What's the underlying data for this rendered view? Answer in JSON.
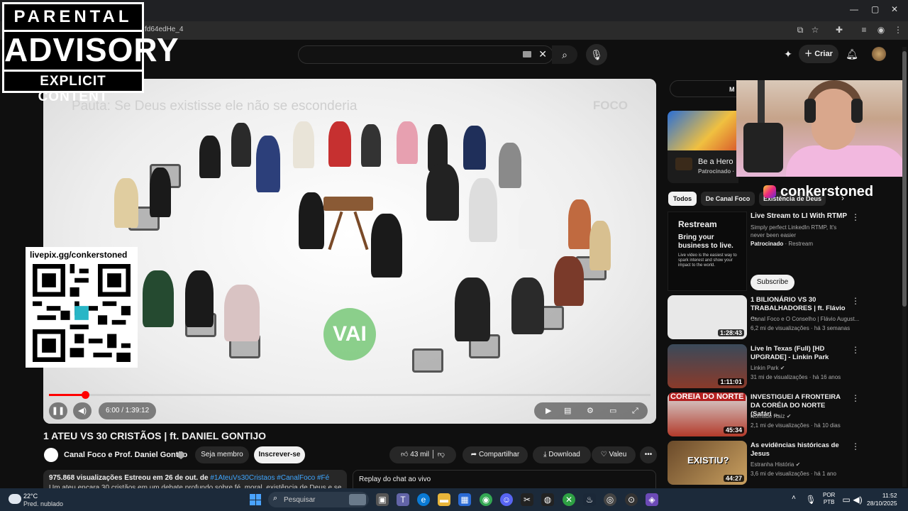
{
  "browser": {
    "url_fragment": "fd64edHe_4",
    "window_controls": {
      "minimize": "—",
      "maximize": "▢",
      "close": "✕"
    }
  },
  "overlay": {
    "parental": {
      "line1": "PARENTAL",
      "line2": "ADVISORY",
      "line3": "EXPLICIT CONTENT"
    },
    "livepix_label": "livepix.gg/conkerstoned",
    "instagram_handle": "conkerstoned"
  },
  "header": {
    "search_placeholder": "",
    "create_label": "Criar"
  },
  "video": {
    "caption": "Pauta: Se Deus existisse ele não se esconderia",
    "brand": "FOCO",
    "badge_text": "VAI",
    "time": "6:00 / 1:39:12",
    "progress_fraction": 0.06
  },
  "meta": {
    "title": "1 ATEU VS 30 CRISTÃOS | ft. DANIEL GONTIJO",
    "channel": "Canal Foco e Prof. Daniel Gontijo",
    "join_label": "Seja membro",
    "subscribe_label": "Inscrever-se",
    "likes": "43 mil",
    "share_label": "Compartilhar",
    "download_label": "Download",
    "valeu_label": "Valeu",
    "more_label": "•••",
    "desc_views": "975.868 visualizações",
    "desc_date": "Estreou em 26 de out. de",
    "desc_tags": "#1AteuVs30Cristaos #CanalFoco #Fé",
    "desc_line2": "Um ateu encara 30 cristãos em um debate profundo sobre fé, moral, existência de Deus e se",
    "chat_label": "Replay do chat ao vivo"
  },
  "sidebar": {
    "banner_label": "M",
    "game_ad": {
      "title": "Be a Hero",
      "sponsor": "Patrocinado · "
    },
    "chips": [
      "Todos",
      "De Canal Foco",
      "Existência de Deus"
    ],
    "restream_ad": {
      "logo": "Restream",
      "headline": "Bring your business to live.",
      "body": "Live video is the easiest way to spark interest and show your impact to the world.",
      "title": "Live Stream to LI With RTMP",
      "desc": "Simply perfect LinkedIn RTMP, It's never been easier",
      "sponsor_bold": "Patrocinado",
      "sponsor_rest": " · Restream",
      "cta": "Subscribe"
    },
    "recommended": [
      {
        "title": "1 BILIONÁRIO VS 30 TRABALHADORES | ft. Flávio ...",
        "channel": "Canal Foco e O Conselho | Flávio August...",
        "meta": "6,2 mi de visualizações · há 3 semanas",
        "duration": "1:28:43",
        "thumb_color": "#e8e8e8"
      },
      {
        "title": "Live In Texas (Full) [HD UPGRADE] - Linkin Park",
        "channel": "Linkin Park ✔",
        "meta": "31 mi de visualizações · há 16 anos",
        "duration": "1:11:01",
        "thumb_color": "#6d4a3a"
      },
      {
        "title": "INVESTIGUEI A FRONTEIRA DA CORÉIA DO NORTE (Safári ...",
        "channel": "Nômade Raiz ✔",
        "meta": "2,1 mi de visualizações · há 10 dias",
        "duration": "45:34",
        "thumb_color": "#c0503a"
      },
      {
        "title": "As evidências históricas de Jesus",
        "channel": "Estranha História ✔",
        "meta": "3,6 mi de visualizações · há 1 ano",
        "duration": "44:27",
        "thumb_color": "#8a6a40"
      }
    ],
    "rec_thumb_text_3": "COREIA DO NORTE",
    "rec_thumb_text_4": "EXISTIU?"
  },
  "taskbar": {
    "temp": "22°C",
    "condition": "Pred. nublado",
    "search_label": "Pesquisar",
    "lang1": "POR",
    "lang2": "PTB",
    "time": "11:52",
    "date": "28/10/2025"
  },
  "colors": {
    "accent_red": "#ff0000",
    "link_blue": "#3ea6ff",
    "background": "#0f0f0f"
  }
}
